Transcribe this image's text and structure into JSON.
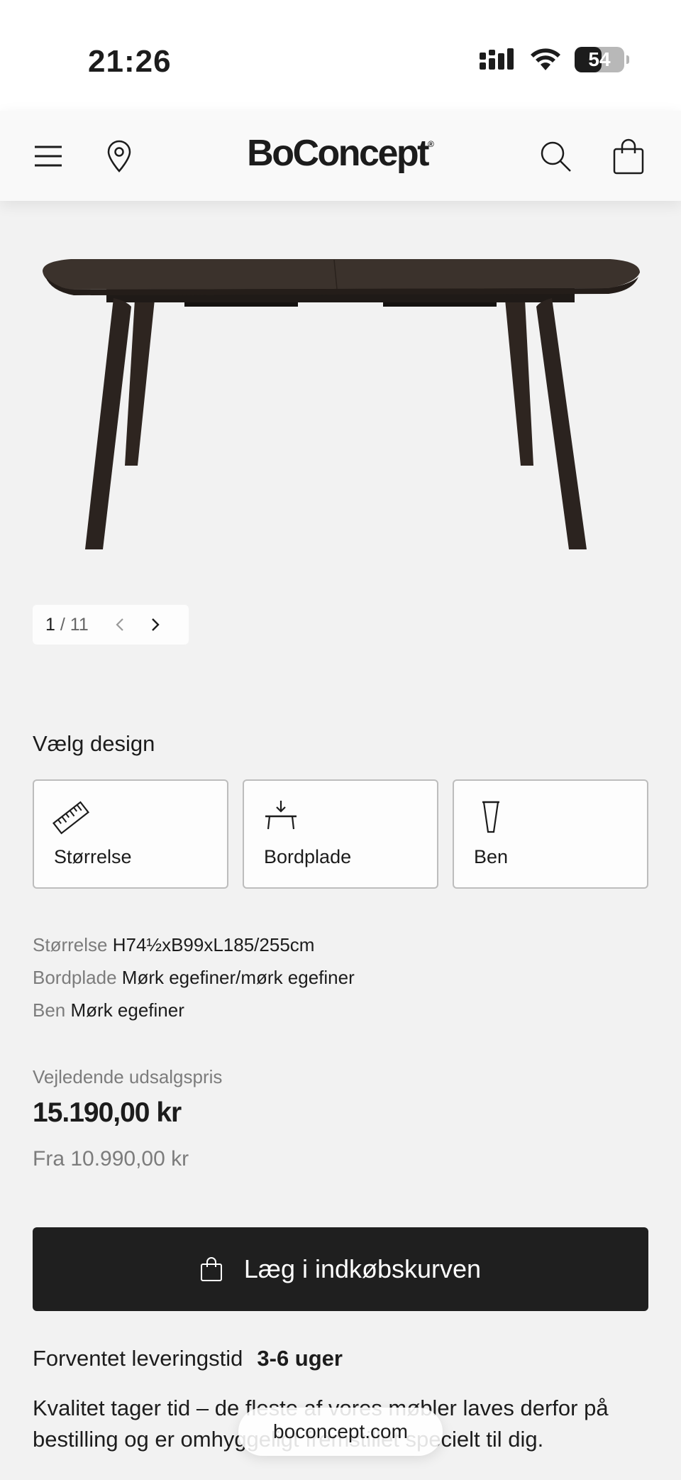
{
  "status_bar": {
    "time": "21:26",
    "battery": "54",
    "battery_level": 54
  },
  "nav": {
    "brand": "BoConcept",
    "icons": [
      "menu-icon",
      "location-pin-icon",
      "search-icon",
      "shopping-bag-icon"
    ]
  },
  "gallery": {
    "current": "1",
    "separator": "/",
    "total": "11"
  },
  "design": {
    "title": "Vælg design",
    "options": [
      {
        "label": "Størrelse",
        "icon": "ruler-icon"
      },
      {
        "label": "Bordplade",
        "icon": "tabletop-icon"
      },
      {
        "label": "Ben",
        "icon": "table-leg-icon"
      }
    ]
  },
  "specs": [
    {
      "key": "Størrelse",
      "value": "H74½xB99xL185/255cm"
    },
    {
      "key": "Bordplade",
      "value": "Mørk egefiner/mørk egefiner"
    },
    {
      "key": "Ben",
      "value": "Mørk egefiner"
    }
  ],
  "pricing": {
    "label": "Vejledende udsalgspris",
    "price": "15.190,00 kr",
    "from": "Fra 10.990,00 kr"
  },
  "cart": {
    "button_label": "Læg i indkøbskurven"
  },
  "delivery": {
    "label": "Forventet leveringstid",
    "value": "3-6 uger"
  },
  "quality": {
    "text": "Kvalitet tager tid – de fleste af vores møbler laves derfor på bestilling og er omhyggeligt fremstillet specielt til dig."
  },
  "browser": {
    "url": "boconcept.com"
  },
  "colors": {
    "background": "#f2f2f2",
    "button": "#1f1f1f",
    "table_wood": "#3b322c"
  }
}
